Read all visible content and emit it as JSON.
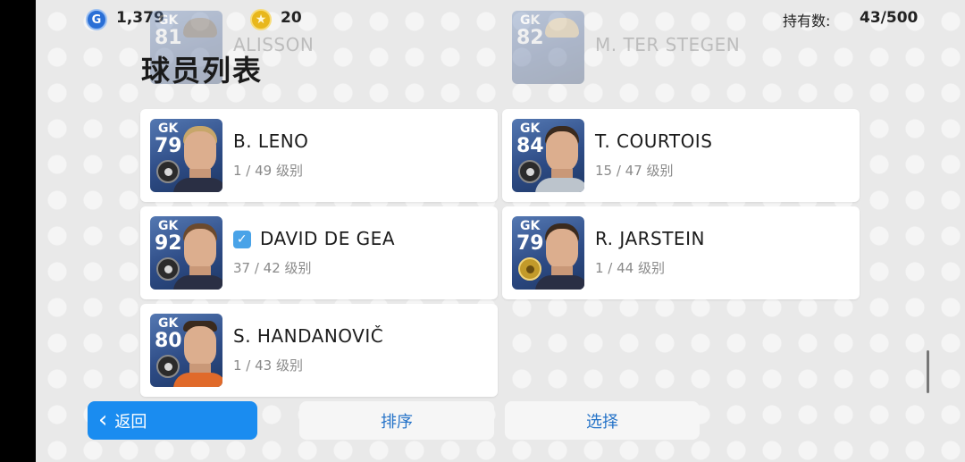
{
  "topbar": {
    "gp_icon": "G",
    "gp_value": "1,379",
    "coin_icon": "★",
    "coin_value": "20",
    "owned_label": "持有数:",
    "owned_value": "43/500"
  },
  "page": {
    "title": "球员列表"
  },
  "players": [
    {
      "position": "GK",
      "rating": "81",
      "name": "ALISSON",
      "level": "",
      "faded": true
    },
    {
      "position": "GK",
      "rating": "82",
      "name": "M. TER STEGEN",
      "level": "",
      "faded": true
    },
    {
      "position": "GK",
      "rating": "79",
      "name": "B. LENO",
      "level": "1 / 49 级别"
    },
    {
      "position": "GK",
      "rating": "84",
      "name": "T. COURTOIS",
      "level": "15 / 47 级别"
    },
    {
      "position": "GK",
      "rating": "92",
      "name": "DAVID DE GEA",
      "level": "37 / 42 级别",
      "checked": true
    },
    {
      "position": "GK",
      "rating": "79",
      "name": "R. JARSTEIN",
      "level": "1 / 44 级别",
      "gold_badge": true
    },
    {
      "position": "GK",
      "rating": "80",
      "name": "S. HANDANOVIČ",
      "level": "1 / 43 级别"
    }
  ],
  "buttons": {
    "back_label": "返回",
    "sort_label": "排序",
    "select_label": "选择"
  },
  "colors": {
    "accent": "#1a8cf0",
    "link": "#2573c8",
    "check": "#49a3e8"
  }
}
